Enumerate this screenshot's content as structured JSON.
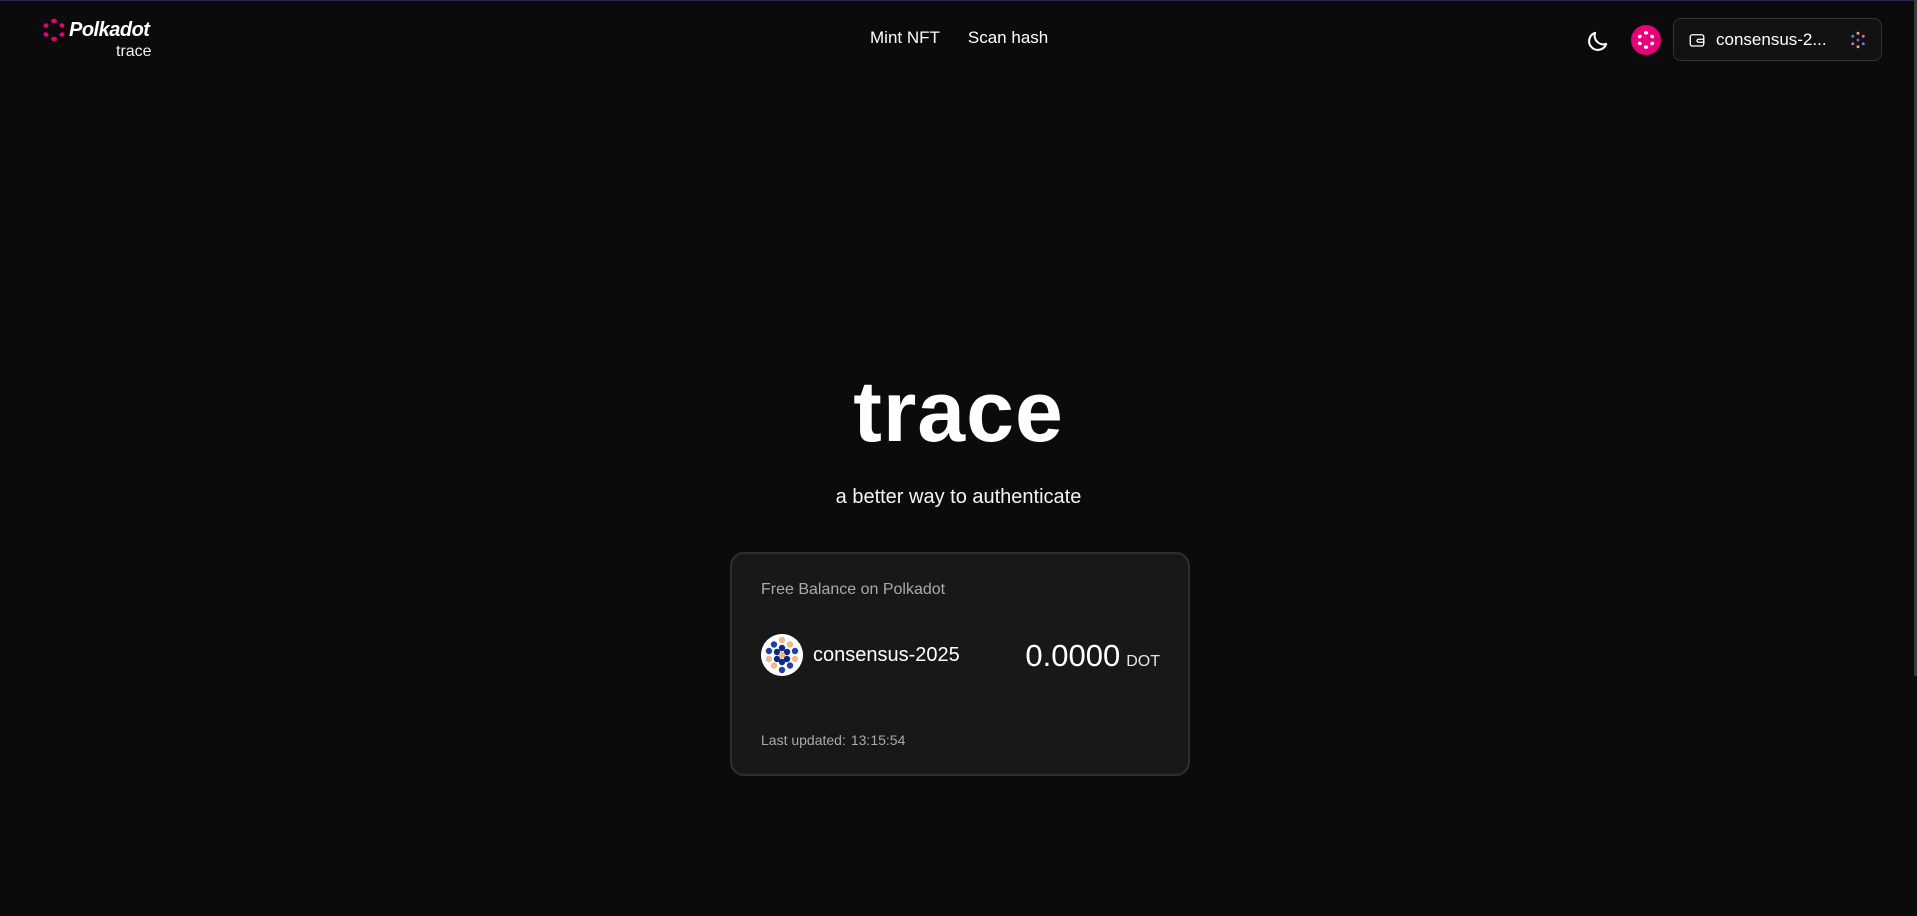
{
  "brand": {
    "name": "Polkadot",
    "sub": "trace"
  },
  "nav": {
    "items": [
      {
        "label": "Mint NFT"
      },
      {
        "label": "Scan hash"
      }
    ]
  },
  "header": {
    "wallet_label": "consensus-2..."
  },
  "hero": {
    "title": "trace",
    "subtitle": "a better way to authenticate"
  },
  "card": {
    "title": "Free Balance on Polkadot",
    "account_name": "consensus-2025",
    "balance": "0.0000",
    "unit": "DOT",
    "last_updated_label": "Last updated:",
    "last_updated_time": "13:15:54"
  },
  "icons": {
    "brand": "polkadot-logo-icon",
    "theme": "moon-icon",
    "network": "polkadot-network-icon",
    "wallet": "wallet-icon",
    "identicon": "identicon-icon"
  },
  "colors": {
    "brand_pink": "#e6007a",
    "background": "#0b0b0b",
    "card": "#181818"
  }
}
